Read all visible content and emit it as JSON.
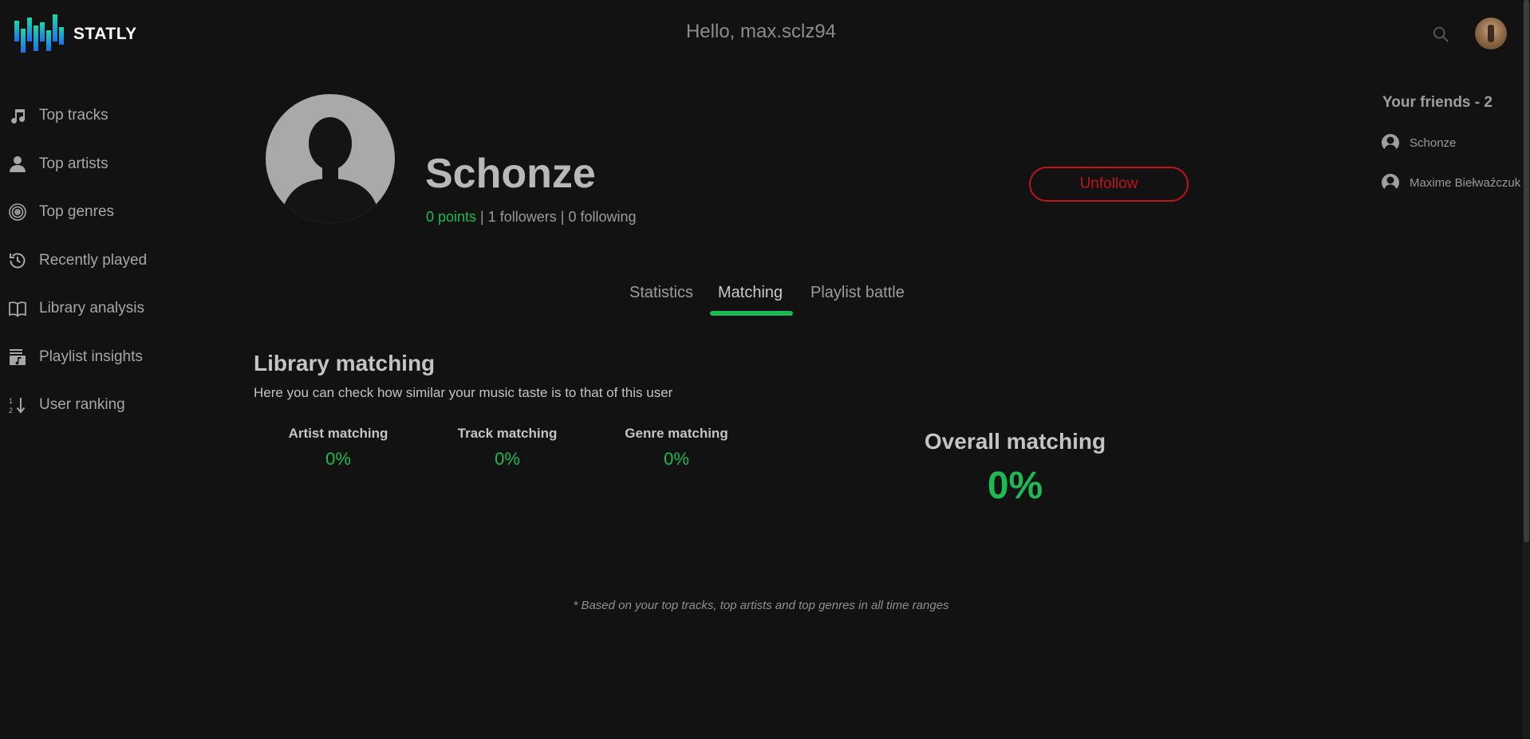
{
  "app": {
    "name": "STATLY"
  },
  "header": {
    "greeting": "Hello, max.sclz94"
  },
  "sidebar": {
    "items": [
      {
        "label": "Top tracks",
        "icon": "music-note-icon"
      },
      {
        "label": "Top artists",
        "icon": "person-icon"
      },
      {
        "label": "Top genres",
        "icon": "vinyl-icon"
      },
      {
        "label": "Recently played",
        "icon": "history-icon"
      },
      {
        "label": "Library analysis",
        "icon": "book-icon"
      },
      {
        "label": "Playlist insights",
        "icon": "playlist-icon"
      },
      {
        "label": "User ranking",
        "icon": "sort-numeric-icon"
      }
    ]
  },
  "profile": {
    "name": "Schonze",
    "points": "0 points",
    "separator": " | ",
    "followers": "1 followers",
    "following": "0 following",
    "unfollow_label": "Unfollow"
  },
  "tabs": [
    {
      "label": "Statistics",
      "active": false
    },
    {
      "label": "Matching",
      "active": true
    },
    {
      "label": "Playlist battle",
      "active": false
    }
  ],
  "matching": {
    "title": "Library matching",
    "description": "Here you can check how similar your music taste is to that of this user",
    "metrics": [
      {
        "label": "Artist matching",
        "value": "0%"
      },
      {
        "label": "Track matching",
        "value": "0%"
      },
      {
        "label": "Genre matching",
        "value": "0%"
      }
    ],
    "overall": {
      "label": "Overall matching",
      "value": "0%"
    },
    "footnote": "* Based on your top tracks, top artists and top genres in all time ranges"
  },
  "friends": {
    "title": "Your friends - 2",
    "list": [
      {
        "name": "Schonze"
      },
      {
        "name": "Maxime Biełwaźczuk"
      }
    ]
  },
  "colors": {
    "background": "#121212",
    "accent": "#1db954",
    "danger": "#c0141a",
    "logo_gradient": [
      "#1ed8a8",
      "#1e6ff0"
    ]
  }
}
